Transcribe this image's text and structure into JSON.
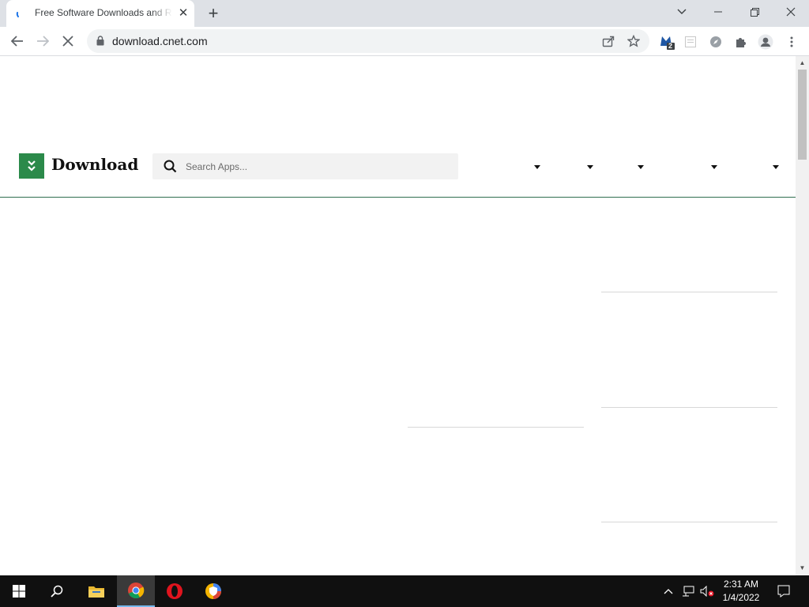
{
  "browser": {
    "tab_title": "Free Software Downloads and Reviews",
    "url": "download.cnet.com",
    "extension_badge": "2",
    "close_tab_glyph": "✕",
    "new_tab_glyph": "+"
  },
  "site": {
    "logo_text": "Download",
    "search_placeholder": "Search Apps...",
    "nav_dropdowns": [
      "",
      "",
      "",
      "",
      ""
    ]
  },
  "taskbar": {
    "time": "2:31 AM",
    "date": "1/4/2022"
  },
  "colors": {
    "brand_green": "#2b8a4a",
    "header_rule": "#2f6e4f",
    "tabstrip": "#dee1e6",
    "taskbar": "#101010"
  }
}
